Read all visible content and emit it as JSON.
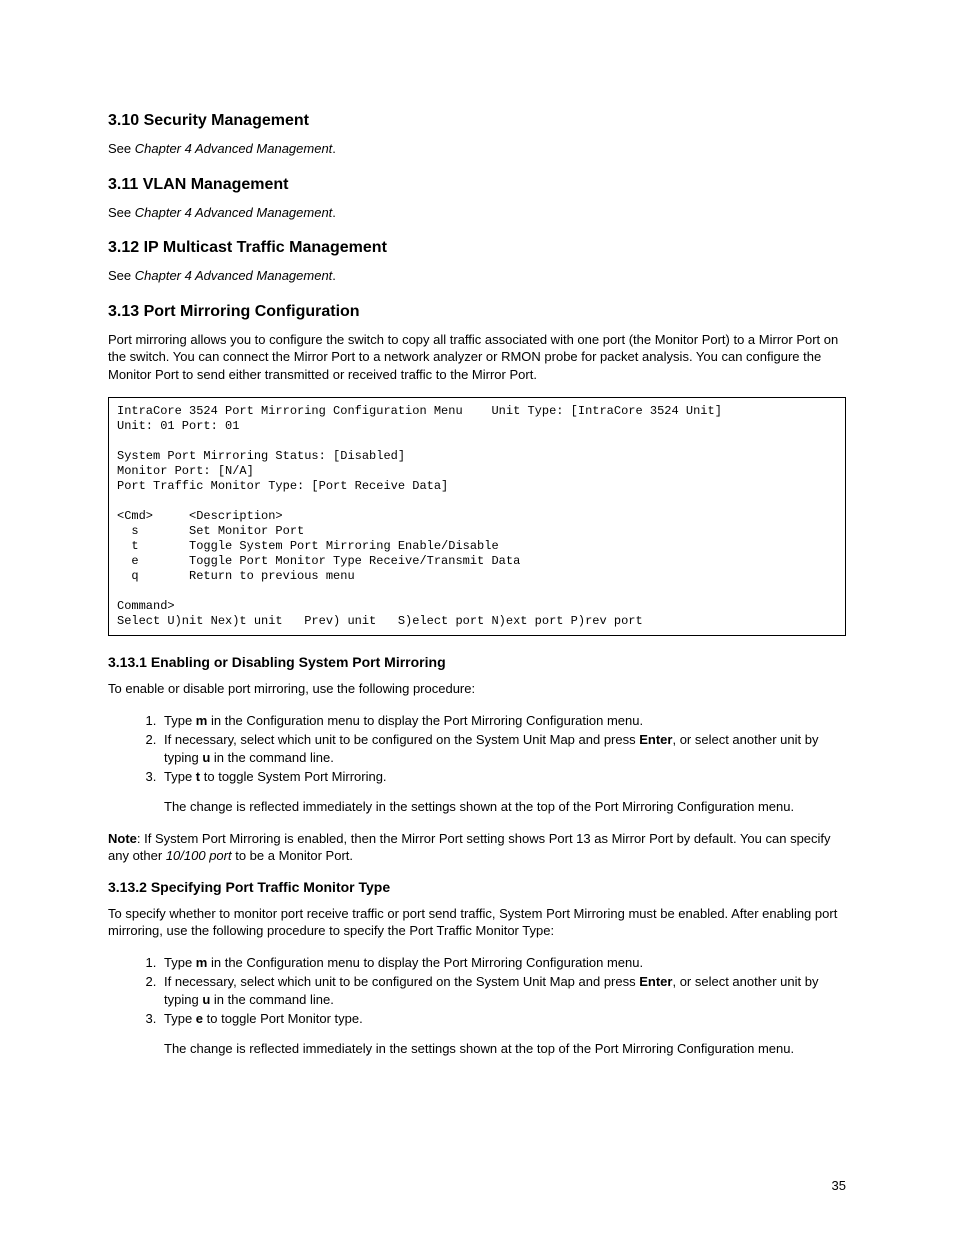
{
  "s310": {
    "heading": "3.10 Security Management",
    "see_prefix": "See ",
    "see_ref": "Chapter 4 Advanced Management",
    "see_suffix": "."
  },
  "s311": {
    "heading": "3.11 VLAN Management",
    "see_prefix": "See ",
    "see_ref": "Chapter 4 Advanced Management",
    "see_suffix": "."
  },
  "s312": {
    "heading": "3.12 IP Multicast Traffic Management",
    "see_prefix": "See ",
    "see_ref": "Chapter 4 Advanced Management",
    "see_suffix": "."
  },
  "s313": {
    "heading": "3.13 Port Mirroring Configuration",
    "intro": "Port mirroring allows you to configure the switch to copy all traffic associated with one port (the Monitor Port) to a Mirror Port on the switch. You can connect the Mirror Port to a network analyzer or RMON probe for packet analysis. You can configure the Monitor Port to send either transmitted or received traffic to the Mirror Port.",
    "terminal": "IntraCore 3524 Port Mirroring Configuration Menu    Unit Type: [IntraCore 3524 Unit]\nUnit: 01 Port: 01\n\nSystem Port Mirroring Status: [Disabled]\nMonitor Port: [N/A]\nPort Traffic Monitor Type: [Port Receive Data]\n\n<Cmd>     <Description>\n  s       Set Monitor Port\n  t       Toggle System Port Mirroring Enable/Disable\n  e       Toggle Port Monitor Type Receive/Transmit Data\n  q       Return to previous menu\n\nCommand>\nSelect U)nit Nex)t unit   Prev) unit   S)elect port N)ext port P)rev port"
  },
  "s3131": {
    "heading": "3.13.1 Enabling or Disabling System Port Mirroring",
    "intro": "To enable or disable port mirroring, use the following procedure:",
    "li1_a": "Type ",
    "li1_b": "m",
    "li1_c": " in the Configuration menu to display the Port Mirroring Configuration menu.",
    "li2_a": "If necessary, select which unit to be configured on the System Unit Map and press ",
    "li2_b": "Enter",
    "li2_c": ", or select another unit by typing ",
    "li2_d": "u",
    "li2_e": " in the command line.",
    "li3_a": "Type ",
    "li3_b": "t",
    "li3_c": " to toggle System Port Mirroring.",
    "li3_trail": "The change is reflected immediately in the settings shown at the top of the Port Mirroring Configuration menu.",
    "note_label": "Note",
    "note_a": ": If System Port Mirroring is enabled, then the Mirror Port setting shows Port 13 as Mirror Port by default. You can specify any other ",
    "note_b": "10/100 port",
    "note_c": " to be a Monitor Port."
  },
  "s3132": {
    "heading": "3.13.2 Specifying Port Traffic Monitor Type",
    "intro": "To specify whether to monitor port receive traffic or port send traffic, System Port Mirroring must be enabled. After enabling port mirroring, use the following procedure to specify the Port Traffic Monitor Type:",
    "li1_a": "Type ",
    "li1_b": "m",
    "li1_c": " in the Configuration menu to display the Port Mirroring Configuration menu.",
    "li2_a": "If necessary, select which unit to be configured on the System Unit Map and press ",
    "li2_b": "Enter",
    "li2_c": ", or select another unit by typing ",
    "li2_d": "u",
    "li2_e": " in the command line.",
    "li3_a": "Type ",
    "li3_b": "e",
    "li3_c": " to toggle Port Monitor type.",
    "li3_trail": "The change is reflected immediately in the settings shown at the top of the Port Mirroring Configuration menu."
  },
  "page_number": "35"
}
